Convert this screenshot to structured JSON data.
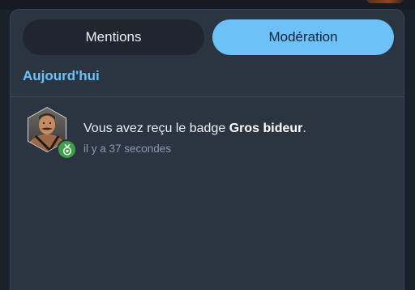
{
  "tabs": [
    {
      "label": "Mentions",
      "active": false
    },
    {
      "label": "Modération",
      "active": true
    }
  ],
  "section": {
    "title": "Aujourd'hui"
  },
  "notification": {
    "text_prefix": "Vous avez reçu le badge ",
    "badge_name": "Gros bideur",
    "text_suffix": ".",
    "time": "il y a 37 secondes",
    "avatar_icon": "user-avatar",
    "badge_icon": "medal-icon"
  },
  "colors": {
    "accent": "#6cc2f7",
    "panel": "#2b3441",
    "badge_green": "#3f9d4c"
  }
}
